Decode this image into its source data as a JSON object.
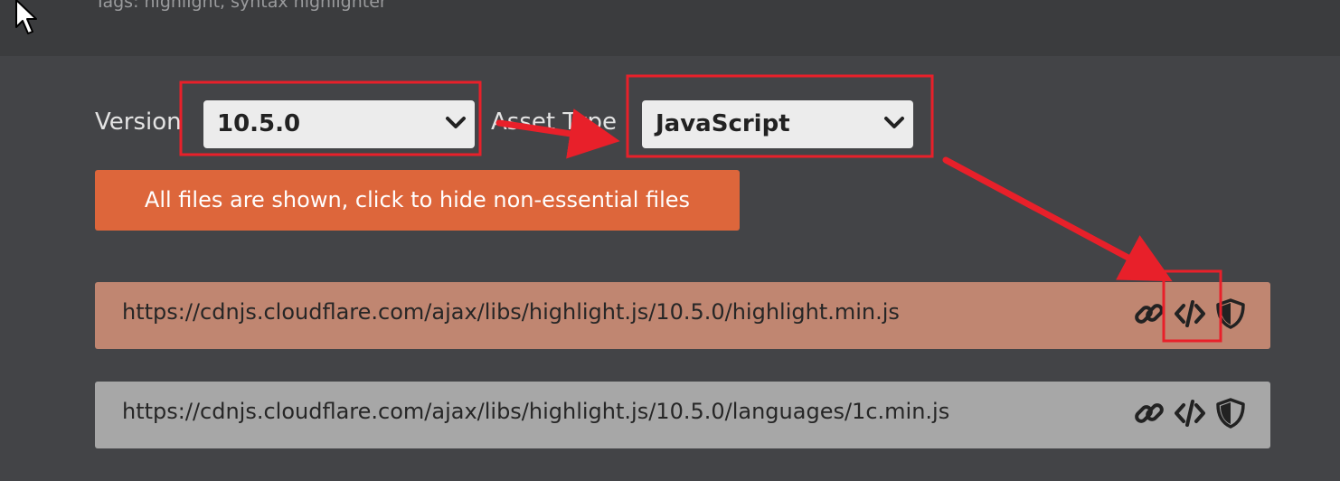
{
  "header": {
    "tags_text": "Tags:  highlight, syntax highlighter"
  },
  "selectors": {
    "version_label": "Version",
    "version_value": "10.5.0",
    "asset_type_label": "Asset Type",
    "asset_type_value": "JavaScript"
  },
  "toggle_button": {
    "label": "All files are shown, click to hide non-essential files"
  },
  "files": [
    {
      "url": "https://cdnjs.cloudflare.com/ajax/libs/highlight.js/10.5.0/highlight.min.js",
      "highlighted": true
    },
    {
      "url": "https://cdnjs.cloudflare.com/ajax/libs/highlight.js/10.5.0/languages/1c.min.js",
      "highlighted": false
    }
  ],
  "icons": {
    "copy_url": "link-icon",
    "copy_script_tag": "code-icon",
    "copy_sri": "shield-icon"
  },
  "colors": {
    "page_bg": "#434447",
    "accent_orange": "#dd663b",
    "highlighted_row": "#c08671",
    "normal_row": "#a7a7a7",
    "annotation_red": "#e8202a"
  }
}
